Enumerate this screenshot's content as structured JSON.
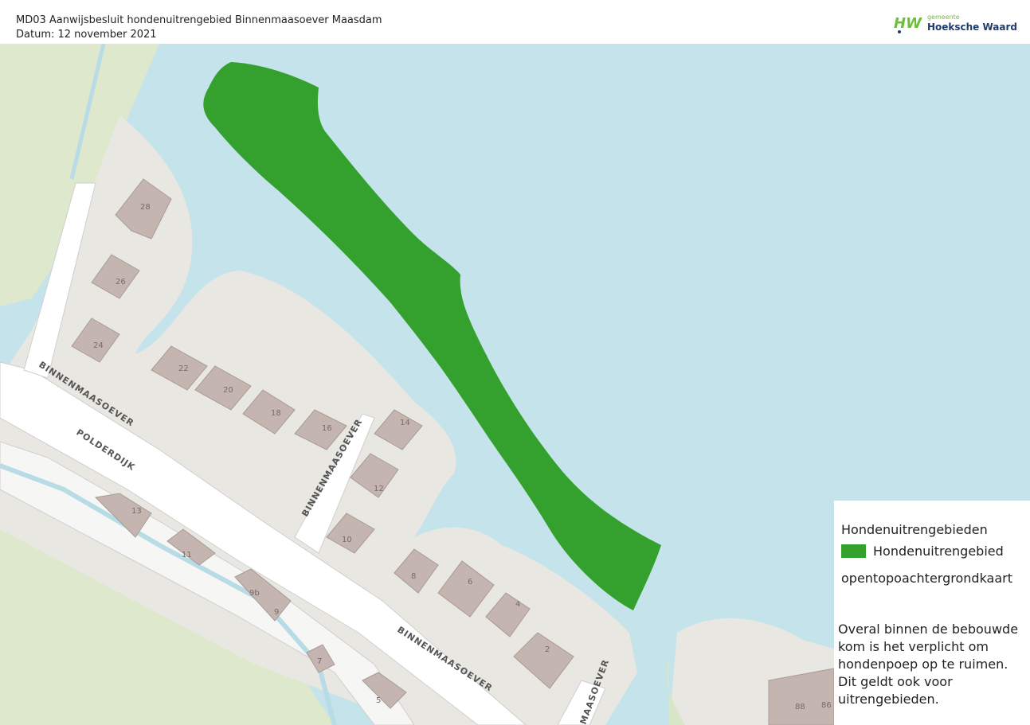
{
  "header": {
    "title": "MD03 Aanwijsbesluit hondenuitrengebied Binnenmaasoever Maasdam",
    "date": "Datum: 12 november 2021"
  },
  "logo": {
    "mark": "HW",
    "small_text": "gemeente",
    "name": "Hoeksche Waard",
    "colors": {
      "green": "#6bbf3a",
      "blue": "#1e3c6e"
    }
  },
  "legend": {
    "heading": "Hondenuitrengebieden",
    "item_label": "Hondenuitrengebied",
    "item_color": "#34a12e",
    "basemap": "opentopoachtergrondkaart",
    "note": "Overal binnen de bebouwde\nkom is het verplicht om\nhondenpoep op te ruimen.\nDit geldt ook voor\nuitrengebieden."
  },
  "map": {
    "colors": {
      "water": "#c5e3ea",
      "land": "#e9e7e1",
      "green": "#d8e6c8",
      "building": "#c4b5b0",
      "road": "#ffffff"
    },
    "street_labels": [
      "BINNENMAASOEVER",
      "POLDERDIJK",
      "BINNENMAASOEVER",
      "BINNENMAASOEVER",
      "MAASOEVER"
    ],
    "house_numbers": [
      "28",
      "26",
      "24",
      "22",
      "20",
      "18",
      "16",
      "14",
      "12",
      "10",
      "8",
      "6",
      "4",
      "2",
      "13",
      "11",
      "9b",
      "9",
      "7",
      "5",
      "88",
      "86"
    ]
  }
}
